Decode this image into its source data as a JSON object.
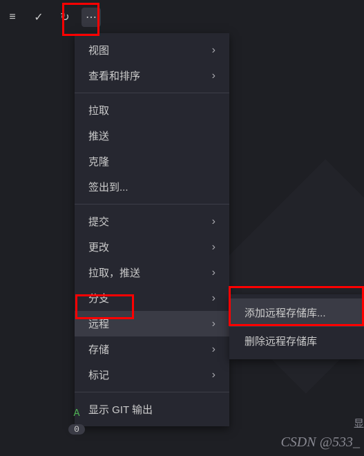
{
  "toolbar": {
    "tree_icon": "≡",
    "check_icon": "✓",
    "refresh_icon": "↻",
    "more_icon": "⋯"
  },
  "menu": {
    "groups": [
      [
        {
          "label": "视图",
          "submenu": true
        },
        {
          "label": "查看和排序",
          "submenu": true
        }
      ],
      [
        {
          "label": "拉取",
          "submenu": false
        },
        {
          "label": "推送",
          "submenu": false
        },
        {
          "label": "克隆",
          "submenu": false
        },
        {
          "label": "签出到...",
          "submenu": false
        }
      ],
      [
        {
          "label": "提交",
          "submenu": true
        },
        {
          "label": "更改",
          "submenu": true
        },
        {
          "label": "拉取，推送",
          "submenu": true
        },
        {
          "label": "分支",
          "submenu": true
        },
        {
          "label": "远程",
          "submenu": true,
          "hover": true
        },
        {
          "label": "存储",
          "submenu": true
        },
        {
          "label": "标记",
          "submenu": true
        }
      ],
      [
        {
          "label": "显示 GIT 输出",
          "submenu": false
        }
      ]
    ]
  },
  "submenu_remote": {
    "items": [
      {
        "label": "添加远程存储库...",
        "hover": true
      },
      {
        "label": "删除远程存储库",
        "hover": false
      }
    ]
  },
  "gutter": {
    "added_marker": "A",
    "count": "0"
  },
  "watermark": "CSDN @533_",
  "watermark_top": "显",
  "chevron": "›"
}
